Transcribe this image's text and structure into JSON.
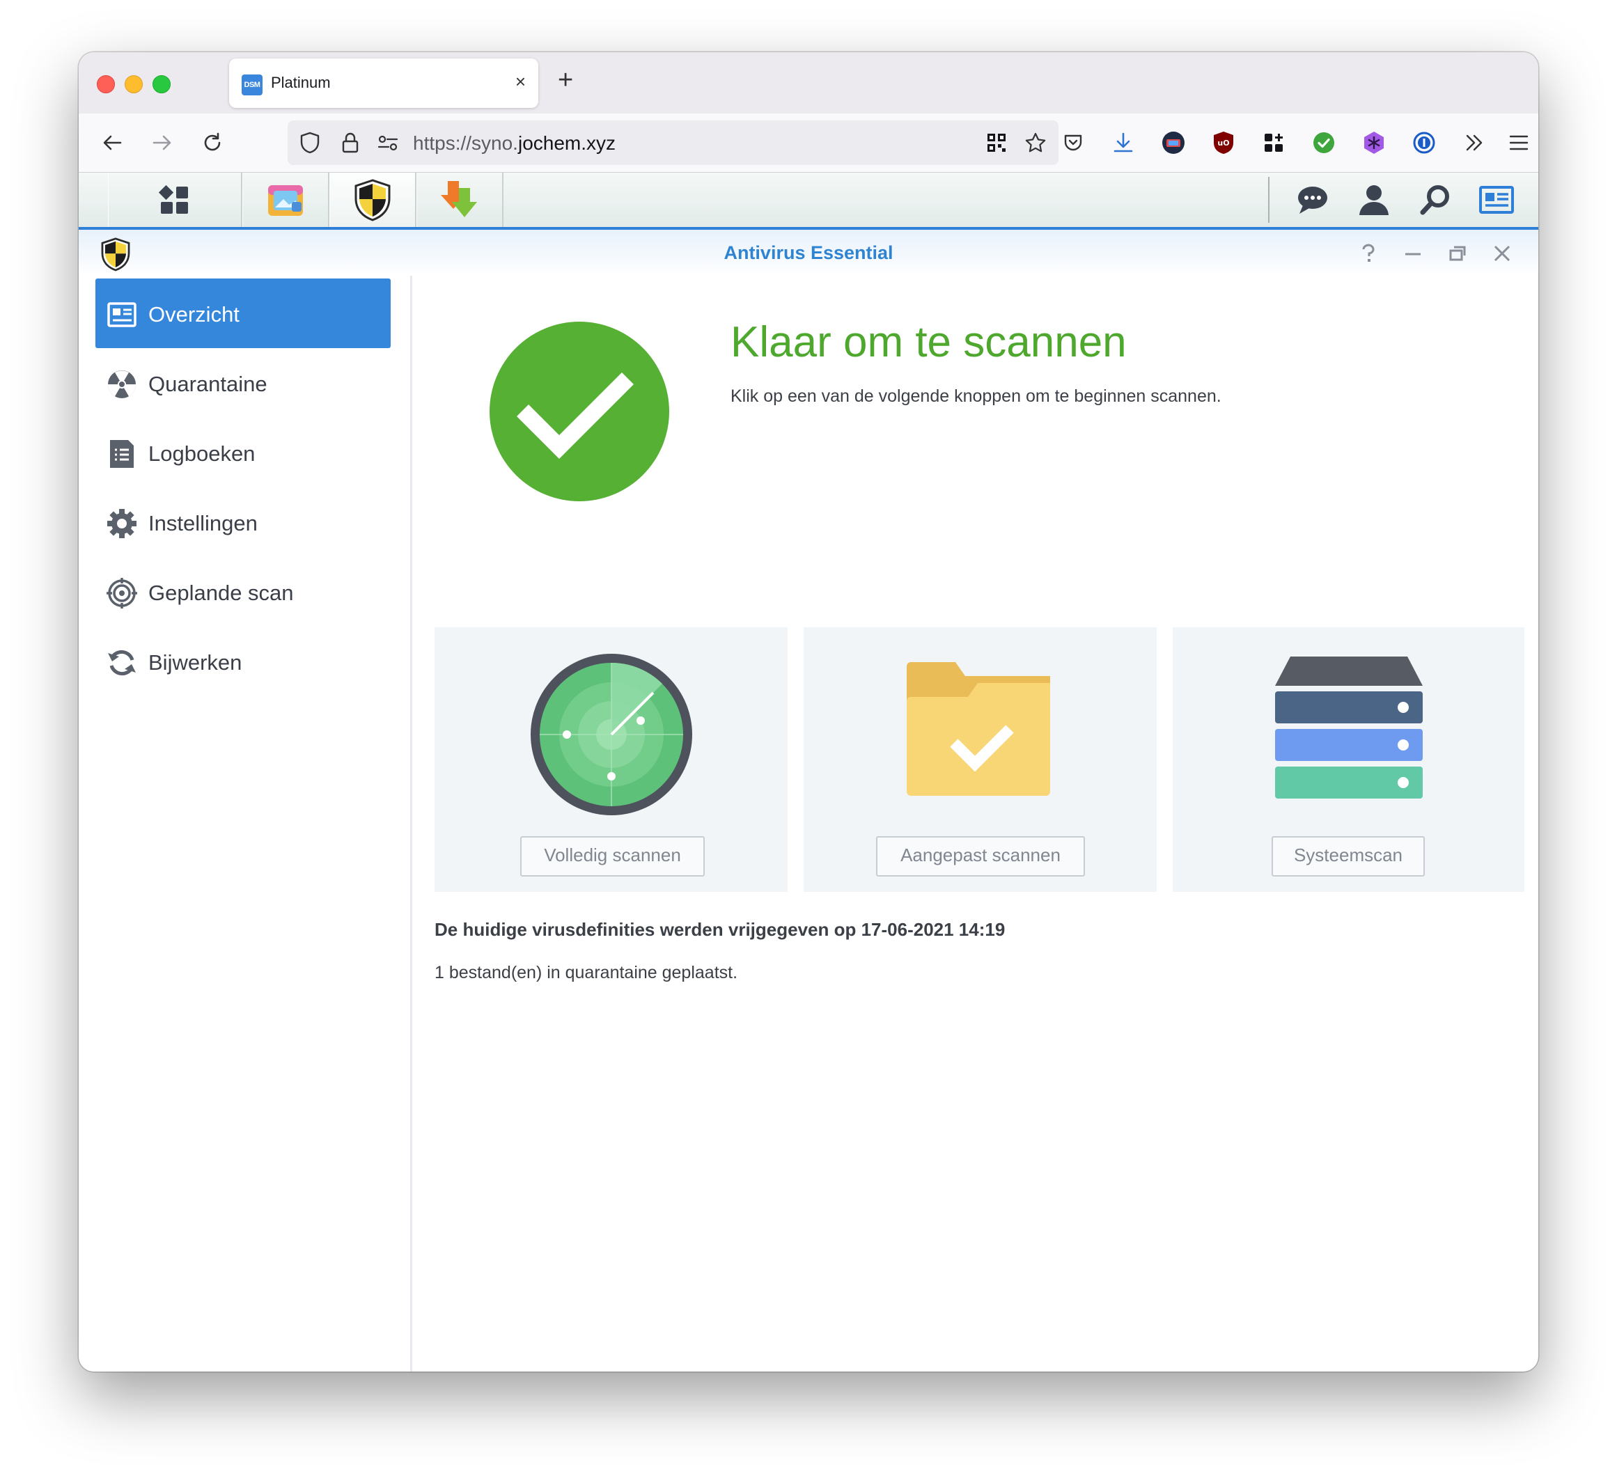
{
  "browser": {
    "tab_title": "Platinum",
    "tab_favicon_text": "DSM",
    "url_prefix": "https://syno.",
    "url_domain": "jochem.xyz",
    "new_tab_symbol": "+",
    "tab_close_symbol": "×"
  },
  "dsm": {
    "taskbar_apps": [
      "main-menu",
      "photo-app",
      "antivirus-app",
      "download-station"
    ],
    "right_icons": [
      "chat-icon",
      "user-icon",
      "search-icon",
      "widgets-icon"
    ]
  },
  "app": {
    "title": "Antivirus Essential",
    "sidebar": [
      {
        "label": "Overzicht",
        "icon": "overview-icon",
        "active": true
      },
      {
        "label": "Quarantaine",
        "icon": "radiation-icon",
        "active": false
      },
      {
        "label": "Logboeken",
        "icon": "log-icon",
        "active": false
      },
      {
        "label": "Instellingen",
        "icon": "gear-icon",
        "active": false
      },
      {
        "label": "Geplande scan",
        "icon": "target-icon",
        "active": false
      },
      {
        "label": "Bijwerken",
        "icon": "refresh-icon",
        "active": false
      }
    ],
    "status": {
      "title": "Klaar om te scannen",
      "subtitle": "Klik op een van de volgende knoppen om te beginnen scannen."
    },
    "scan_cards": [
      {
        "button": "Volledig scannen",
        "icon": "radar-icon"
      },
      {
        "button": "Aangepast scannen",
        "icon": "folder-check-icon"
      },
      {
        "button": "Systeemscan",
        "icon": "server-icon"
      }
    ],
    "definitions_text": "De huidige virusdefinities werden vrijgegeven op 17-06-2021 14:19",
    "quarantine_text": "1 bestand(en) in quarantaine geplaatst."
  },
  "colors": {
    "accent": "#3587dc",
    "success": "#4ea82d",
    "title_blue": "#2f84d2"
  }
}
